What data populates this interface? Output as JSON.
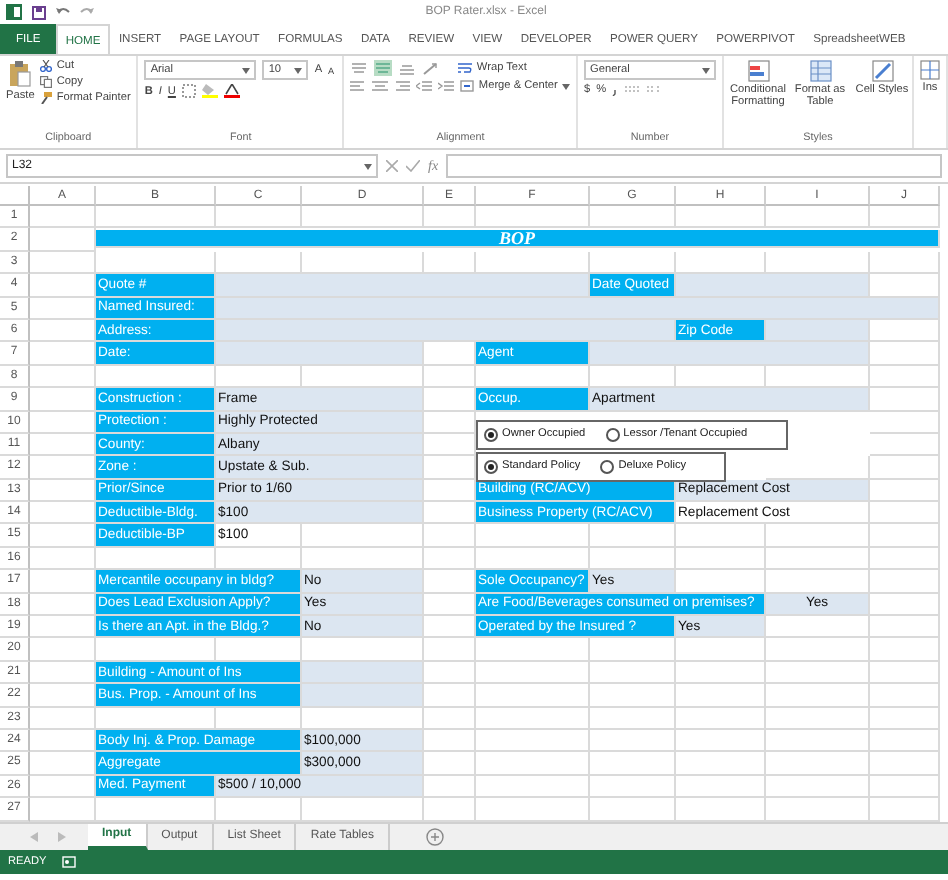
{
  "window": {
    "title": "BOP Rater.xlsx - Excel"
  },
  "ribbon_tabs": [
    {
      "label": "FILE",
      "kind": "file",
      "selected": false
    },
    {
      "label": "HOME",
      "kind": "tab",
      "selected": true
    },
    {
      "label": "INSERT",
      "kind": "tab",
      "selected": false
    },
    {
      "label": "PAGE LAYOUT",
      "kind": "tab",
      "selected": false
    },
    {
      "label": "FORMULAS",
      "kind": "tab",
      "selected": false
    },
    {
      "label": "DATA",
      "kind": "tab",
      "selected": false
    },
    {
      "label": "REVIEW",
      "kind": "tab",
      "selected": false
    },
    {
      "label": "VIEW",
      "kind": "tab",
      "selected": false
    },
    {
      "label": "DEVELOPER",
      "kind": "tab",
      "selected": false
    },
    {
      "label": "POWER QUERY",
      "kind": "tab",
      "selected": false
    },
    {
      "label": "POWERPIVOT",
      "kind": "tab",
      "selected": false
    },
    {
      "label": "SpreadsheetWEB",
      "kind": "tab",
      "selected": false
    }
  ],
  "ribbon": {
    "clipboard": {
      "paste": "Paste",
      "cut": "Cut",
      "copy": "Copy",
      "format_painter": "Format Painter",
      "caption": "Clipboard"
    },
    "font": {
      "name": "Arial",
      "size": "10",
      "grow": "A",
      "shrink": "A",
      "bold": "B",
      "italic": "I",
      "underline": "U",
      "caption": "Font"
    },
    "alignment": {
      "wrap": "Wrap Text",
      "merge": "Merge & Center",
      "caption": "Alignment"
    },
    "number": {
      "format": "General",
      "currency": "$",
      "percent": "%",
      "caption": "Number"
    },
    "styles": {
      "conditional": "Conditional Formatting",
      "format_table": "Format as Table",
      "cell_styles": "Cell Styles",
      "caption": "Styles"
    },
    "cells_cut": "Ins"
  },
  "formula_bar": {
    "name_box": "L32",
    "fx": "fx"
  },
  "sheet": {
    "columns": [
      "A",
      "B",
      "C",
      "D",
      "E",
      "F",
      "G",
      "H",
      "I",
      "J"
    ],
    "rows": [
      {
        "number": "1"
      },
      {
        "number": "2",
        "cells": [
          {
            "kind": "blank"
          },
          {
            "kind": "title",
            "text": "BOP"
          },
          {
            "kind": "merge"
          },
          {
            "kind": "merge"
          },
          {
            "kind": "merge"
          },
          {
            "kind": "merge"
          },
          {
            "kind": "merge"
          },
          {
            "kind": "merge"
          },
          {
            "kind": "merge"
          },
          {
            "kind": "merge"
          }
        ]
      },
      {
        "number": "3"
      },
      {
        "number": "4",
        "cells": [
          {
            "kind": "blank"
          },
          {
            "kind": "label",
            "text": "Quote #"
          },
          {
            "kind": "value"
          },
          {
            "kind": "merge"
          },
          {
            "kind": "merge"
          },
          {
            "kind": "merge"
          },
          {
            "kind": "label",
            "text": "Date Quoted"
          },
          {
            "kind": "value"
          },
          {
            "kind": "merge"
          }
        ]
      },
      {
        "number": "5",
        "cells": [
          {
            "kind": "blank"
          },
          {
            "kind": "label",
            "text": "Named Insured:"
          },
          {
            "kind": "value"
          },
          {
            "kind": "merge"
          },
          {
            "kind": "merge"
          },
          {
            "kind": "merge"
          },
          {
            "kind": "merge"
          },
          {
            "kind": "merge"
          },
          {
            "kind": "merge"
          },
          {
            "kind": "merge"
          }
        ]
      },
      {
        "number": "6",
        "cells": [
          {
            "kind": "blank"
          },
          {
            "kind": "label",
            "text": "Address:"
          },
          {
            "kind": "value"
          },
          {
            "kind": "merge"
          },
          {
            "kind": "merge"
          },
          {
            "kind": "merge"
          },
          {
            "kind": "merge"
          },
          {
            "kind": "label",
            "text": "Zip Code"
          },
          {
            "kind": "value"
          }
        ]
      },
      {
        "number": "7",
        "cells": [
          {
            "kind": "blank"
          },
          {
            "kind": "label",
            "text": "Date:"
          },
          {
            "kind": "value"
          },
          {
            "kind": "merge"
          },
          {
            "kind": "blank"
          },
          {
            "kind": "label",
            "text": "Agent"
          },
          {
            "kind": "value"
          },
          {
            "kind": "merge"
          },
          {
            "kind": "merge"
          }
        ]
      },
      {
        "number": "8"
      },
      {
        "number": "9",
        "cells": [
          {
            "kind": "blank"
          },
          {
            "kind": "label",
            "text": "Construction :"
          },
          {
            "kind": "value",
            "text": "Frame"
          },
          {
            "kind": "merge"
          },
          {
            "kind": "blank"
          },
          {
            "kind": "label",
            "text": "Occup."
          },
          {
            "kind": "value",
            "text": "Apartment"
          },
          {
            "kind": "merge"
          },
          {
            "kind": "merge"
          }
        ]
      },
      {
        "number": "10",
        "cells": [
          {
            "kind": "blank"
          },
          {
            "kind": "label",
            "text": "Protection :"
          },
          {
            "kind": "value",
            "text": "Highly Protected"
          },
          {
            "kind": "merge"
          }
        ]
      },
      {
        "number": "11",
        "cells": [
          {
            "kind": "blank"
          },
          {
            "kind": "label",
            "text": "County:"
          },
          {
            "kind": "value",
            "text": "Albany"
          },
          {
            "kind": "merge"
          }
        ]
      },
      {
        "number": "12",
        "cells": [
          {
            "kind": "blank"
          },
          {
            "kind": "label",
            "text": "Zone :"
          },
          {
            "kind": "value",
            "text": "Upstate & Sub."
          },
          {
            "kind": "merge"
          }
        ]
      },
      {
        "number": "13",
        "cells": [
          {
            "kind": "blank"
          },
          {
            "kind": "label",
            "text": "Prior/Since"
          },
          {
            "kind": "value",
            "text": "Prior to 1/60"
          },
          {
            "kind": "merge"
          },
          {
            "kind": "blank"
          },
          {
            "kind": "label",
            "text": "Building (RC/ACV)"
          },
          {
            "kind": "merge"
          },
          {
            "kind": "value",
            "text": "Replacement Cost"
          },
          {
            "kind": "merge"
          }
        ]
      },
      {
        "number": "14",
        "cells": [
          {
            "kind": "blank"
          },
          {
            "kind": "label",
            "text": "Deductible-Bldg."
          },
          {
            "kind": "value",
            "text": "$100"
          },
          {
            "kind": "merge"
          },
          {
            "kind": "blank"
          },
          {
            "kind": "label",
            "text": "Business Property (RC/ACV)"
          },
          {
            "kind": "merge"
          },
          {
            "kind": "plain",
            "text": "Replacement Cost"
          },
          {
            "kind": "merge"
          }
        ]
      },
      {
        "number": "15",
        "cells": [
          {
            "kind": "blank"
          },
          {
            "kind": "label",
            "text": "Deductible-BP"
          },
          {
            "kind": "plain",
            "text": "$100"
          }
        ]
      },
      {
        "number": "16"
      },
      {
        "number": "17",
        "cells": [
          {
            "kind": "blank"
          },
          {
            "kind": "label",
            "text": "Mercantile occupany in bldg?"
          },
          {
            "kind": "merge"
          },
          {
            "kind": "value",
            "text": "No"
          },
          {
            "kind": "blank"
          },
          {
            "kind": "label",
            "text": "Sole Occupancy?"
          },
          {
            "kind": "value",
            "text": "Yes"
          }
        ]
      },
      {
        "number": "18",
        "cells": [
          {
            "kind": "blank"
          },
          {
            "kind": "label",
            "text": "Does Lead Exclusion Apply?"
          },
          {
            "kind": "merge"
          },
          {
            "kind": "value",
            "text": "Yes"
          },
          {
            "kind": "blank"
          },
          {
            "kind": "label",
            "text": "Are Food/Beverages consumed on premises?"
          },
          {
            "kind": "merge"
          },
          {
            "kind": "merge"
          },
          {
            "kind": "centered",
            "text": "Yes"
          }
        ]
      },
      {
        "number": "19",
        "cells": [
          {
            "kind": "blank"
          },
          {
            "kind": "label",
            "text": "Is there an Apt. in the Bldg.?"
          },
          {
            "kind": "merge"
          },
          {
            "kind": "value",
            "text": "No"
          },
          {
            "kind": "blank"
          },
          {
            "kind": "label",
            "text": "Operated by  the Insured ?"
          },
          {
            "kind": "merge"
          },
          {
            "kind": "value",
            "text": "Yes"
          }
        ]
      },
      {
        "number": "20"
      },
      {
        "number": "21",
        "cells": [
          {
            "kind": "blank"
          },
          {
            "kind": "label",
            "text": "Building - Amount of Ins"
          },
          {
            "kind": "merge"
          },
          {
            "kind": "value"
          }
        ]
      },
      {
        "number": "22",
        "cells": [
          {
            "kind": "blank"
          },
          {
            "kind": "label",
            "text": "Bus. Prop. - Amount of Ins"
          },
          {
            "kind": "merge"
          },
          {
            "kind": "value"
          }
        ]
      },
      {
        "number": "23"
      },
      {
        "number": "24",
        "cells": [
          {
            "kind": "blank"
          },
          {
            "kind": "label",
            "text": "Body Inj. & Prop. Damage"
          },
          {
            "kind": "merge"
          },
          {
            "kind": "value",
            "text": "$100,000"
          }
        ]
      },
      {
        "number": "25",
        "cells": [
          {
            "kind": "blank"
          },
          {
            "kind": "label",
            "text": "Aggregate"
          },
          {
            "kind": "merge"
          },
          {
            "kind": "value",
            "text": "$300,000"
          }
        ]
      },
      {
        "number": "26",
        "cells": [
          {
            "kind": "blank"
          },
          {
            "kind": "label",
            "text": "Med. Payment"
          },
          {
            "kind": "value",
            "text": "$500 / 10,000"
          },
          {
            "kind": "merge"
          }
        ]
      },
      {
        "number": "27"
      }
    ],
    "option_groups": [
      {
        "options": [
          {
            "label": "Owner Occupied",
            "selected": true
          },
          {
            "label": "Lessor /Tenant Occupied",
            "selected": false
          }
        ]
      },
      {
        "options": [
          {
            "label": "Standard Policy",
            "selected": true
          },
          {
            "label": "Deluxe Policy",
            "selected": false
          }
        ]
      }
    ]
  },
  "sheet_tabs": [
    {
      "label": "Input",
      "selected": true
    },
    {
      "label": "Output",
      "selected": false
    },
    {
      "label": "List Sheet",
      "selected": false
    },
    {
      "label": "Rate Tables",
      "selected": false
    }
  ],
  "status_bar": {
    "mode": "READY"
  }
}
